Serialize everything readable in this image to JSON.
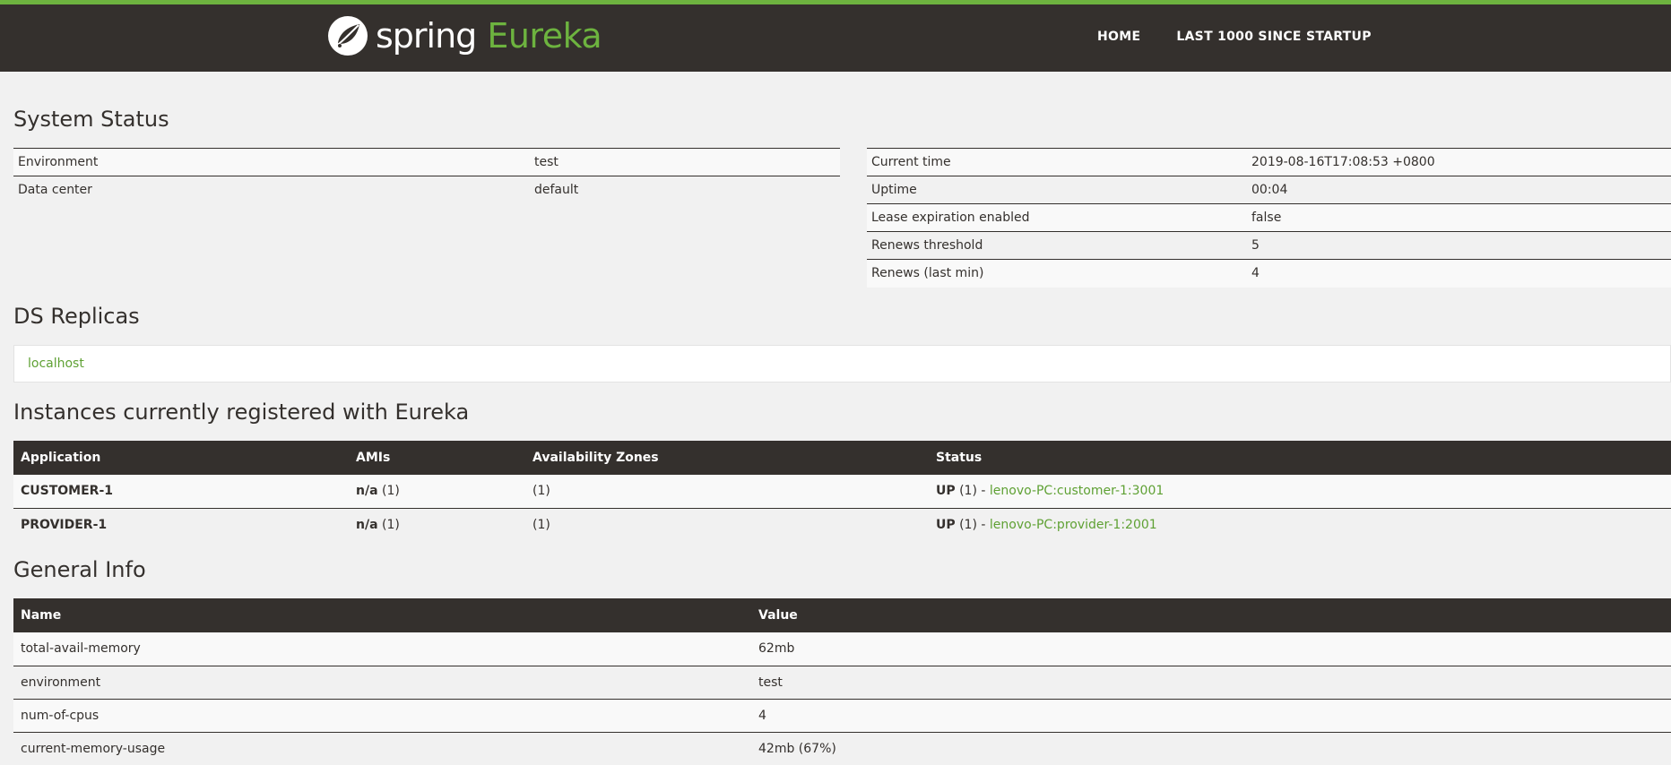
{
  "header": {
    "brand_spring": "spring",
    "brand_eureka": "Eureka",
    "nav": [
      "HOME",
      "LAST 1000 SINCE STARTUP"
    ]
  },
  "system_status": {
    "title": "System Status",
    "left": [
      {
        "key": "Environment",
        "value": "test"
      },
      {
        "key": "Data center",
        "value": "default"
      }
    ],
    "right": [
      {
        "key": "Current time",
        "value": "2019-08-16T17:08:53 +0800"
      },
      {
        "key": "Uptime",
        "value": "00:04"
      },
      {
        "key": "Lease expiration enabled",
        "value": "false"
      },
      {
        "key": "Renews threshold",
        "value": "5"
      },
      {
        "key": "Renews (last min)",
        "value": "4"
      }
    ]
  },
  "ds_replicas": {
    "title": "DS Replicas",
    "items": [
      "localhost"
    ]
  },
  "instances": {
    "title": "Instances currently registered with Eureka",
    "columns": [
      "Application",
      "AMIs",
      "Availability Zones",
      "Status"
    ],
    "rows": [
      {
        "application": "CUSTOMER-1",
        "amis_bold": "n/a",
        "amis_count": "(1)",
        "zones": "(1)",
        "status_bold": "UP",
        "status_count": "(1) -",
        "instance_link": "lenovo-PC:customer-1:3001"
      },
      {
        "application": "PROVIDER-1",
        "amis_bold": "n/a",
        "amis_count": "(1)",
        "zones": "(1)",
        "status_bold": "UP",
        "status_count": "(1) -",
        "instance_link": "lenovo-PC:provider-1:2001"
      }
    ]
  },
  "general_info": {
    "title": "General Info",
    "columns": [
      "Name",
      "Value"
    ],
    "rows": [
      {
        "name": "total-avail-memory",
        "value": "62mb"
      },
      {
        "name": "environment",
        "value": "test"
      },
      {
        "name": "num-of-cpus",
        "value": "4"
      },
      {
        "name": "current-memory-usage",
        "value": "42mb (67%)"
      }
    ]
  },
  "colors": {
    "brand_green": "#6db33f",
    "link_green": "#5fa134",
    "header_dark": "#34302d"
  }
}
